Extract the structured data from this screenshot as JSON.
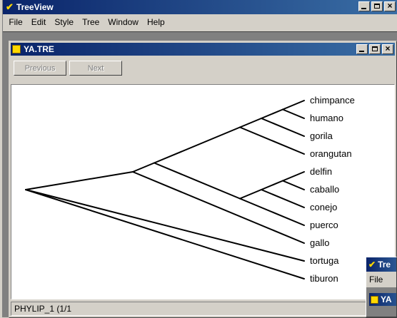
{
  "app": {
    "title": "TreeView",
    "menu": [
      "File",
      "Edit",
      "Style",
      "Tree",
      "Window",
      "Help"
    ],
    "menu_mnemonics": [
      "F",
      "E",
      "S",
      "T",
      "W",
      "H"
    ]
  },
  "child": {
    "title": "YA.TRE",
    "previous_label": "Previous",
    "next_label": "Next",
    "status": "PHYLIP_1 (1/1"
  },
  "tree": {
    "leaves": [
      "chimpance",
      "humano",
      "gorila",
      "orangutan",
      "delfin",
      "caballo",
      "conejo",
      "puerco",
      "gallo",
      "tortuga",
      "tiburon"
    ],
    "newick": "((((((chimpance,humano),gorila),orangutan),(((delfin,caballo),conejo),puerco)),gallo),tortuga,tiburon);"
  },
  "second_window": {
    "title": "Tre",
    "menu_first": "File",
    "child_title": "YA"
  },
  "colors": {
    "titlebar_start": "#0a246a",
    "titlebar_end": "#3a6ea5",
    "face": "#d4d0c8",
    "canvas": "#ffffff"
  }
}
